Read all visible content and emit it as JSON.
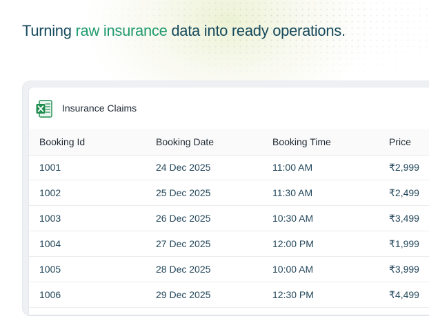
{
  "headline": {
    "part1": "Turning ",
    "accent": "raw insurance",
    "part2": " data into ready operations."
  },
  "card": {
    "icon": "excel-spreadsheet-icon",
    "title": "Insurance Claims"
  },
  "table": {
    "columns": [
      "Booking Id",
      "Booking Date",
      "Booking Time",
      "Price"
    ],
    "rows": [
      [
        "1001",
        "24 Dec 2025",
        "11:00 AM",
        "₹2,999"
      ],
      [
        "1002",
        "25 Dec 2025",
        "11:30 AM",
        "₹2,499"
      ],
      [
        "1003",
        "26 Dec 2025",
        "10:30 AM",
        "₹3,499"
      ],
      [
        "1004",
        "27 Dec 2025",
        "12:00 PM",
        "₹1,999"
      ],
      [
        "1005",
        "28 Dec 2025",
        "10:00 AM",
        "₹3,999"
      ],
      [
        "1006",
        "29 Dec 2025",
        "12:30 PM",
        "₹4,499"
      ]
    ]
  },
  "colors": {
    "headline": "#164a5c",
    "accent": "#1f9a6e",
    "excel_green": "#1e8c4e",
    "cell_text": "#22465a"
  }
}
